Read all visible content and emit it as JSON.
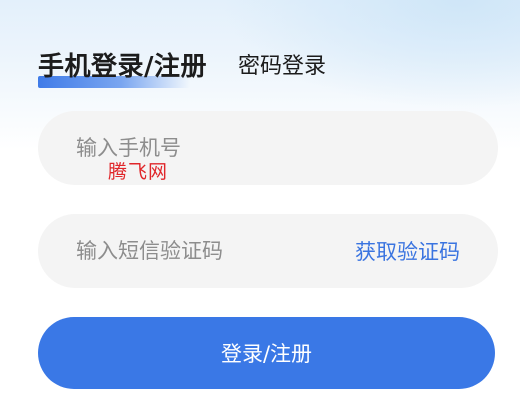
{
  "tabs": {
    "active_label": "手机登录/注册",
    "inactive_label": "密码登录"
  },
  "phone_field": {
    "placeholder": "输入手机号",
    "value": ""
  },
  "code_field": {
    "placeholder": "输入短信验证码",
    "value": "",
    "get_code_label": "获取验证码"
  },
  "watermark": {
    "text": "腾飞网"
  },
  "submit": {
    "label": "登录/注册"
  },
  "colors": {
    "accent": "#3a78e6",
    "link": "#3a74e0",
    "field_bg": "#f4f4f4",
    "watermark": "#e0262a"
  }
}
